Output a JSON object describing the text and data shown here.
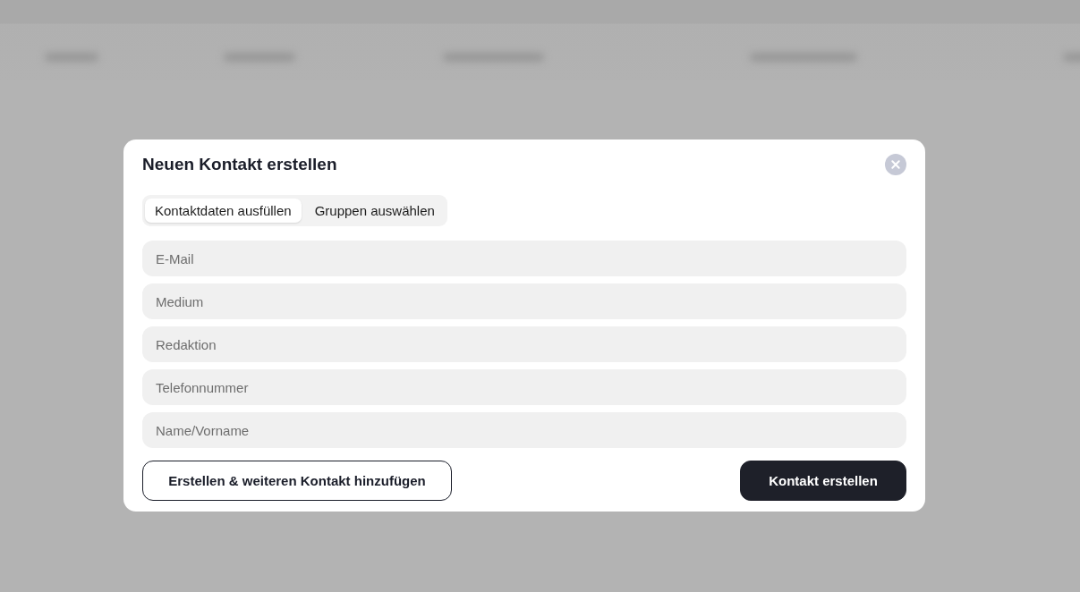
{
  "dialog": {
    "title": "Neuen Kontakt erstellen"
  },
  "tabs": [
    {
      "label": "Kontaktdaten ausfüllen",
      "selected": true
    },
    {
      "label": "Gruppen auswählen",
      "selected": false
    }
  ],
  "fields": [
    {
      "placeholder": "E-Mail"
    },
    {
      "placeholder": "Medium"
    },
    {
      "placeholder": "Redaktion"
    },
    {
      "placeholder": "Telefonnummer"
    },
    {
      "placeholder": "Name/Vorname"
    }
  ],
  "buttons": [
    {
      "label": "Erstellen & weiteren Kontakt hinzufügen",
      "kind": "secondary"
    },
    {
      "label": "Kontakt erstellen",
      "kind": "primary"
    }
  ]
}
